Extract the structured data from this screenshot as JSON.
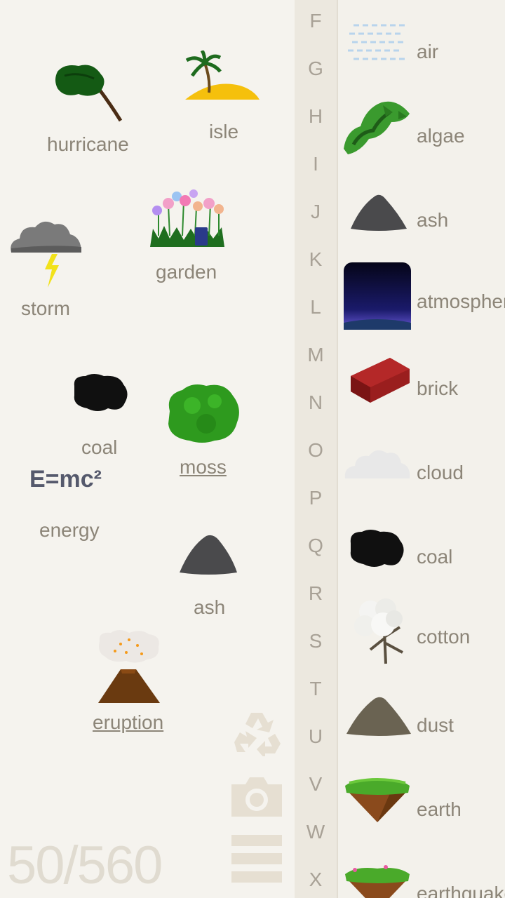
{
  "workspace": {
    "elements": [
      {
        "label": "hurricane"
      },
      {
        "label": "isle"
      },
      {
        "label": "storm"
      },
      {
        "label": "garden"
      },
      {
        "label": "coal"
      },
      {
        "label": "moss"
      },
      {
        "label": "energy",
        "formula": "E=mc²"
      },
      {
        "label": "ash"
      },
      {
        "label": "eruption"
      }
    ],
    "counter": "50/560"
  },
  "letters": [
    "F",
    "G",
    "H",
    "I",
    "J",
    "K",
    "L",
    "M",
    "N",
    "O",
    "P",
    "Q",
    "R",
    "S",
    "T",
    "U",
    "V",
    "W",
    "X"
  ],
  "library": [
    {
      "name": "air",
      "icon": "air-icon"
    },
    {
      "name": "algae",
      "icon": "algae-icon"
    },
    {
      "name": "ash",
      "icon": "ash-icon"
    },
    {
      "name": "atmosphere",
      "icon": "atmosphere-icon"
    },
    {
      "name": "brick",
      "icon": "brick-icon"
    },
    {
      "name": "cloud",
      "icon": "cloud-icon"
    },
    {
      "name": "coal",
      "icon": "coal-icon"
    },
    {
      "name": "cotton",
      "icon": "cotton-icon"
    },
    {
      "name": "dust",
      "icon": "dust-icon"
    },
    {
      "name": "earth",
      "icon": "earth-icon"
    },
    {
      "name": "earthquake",
      "icon": "earthquake-icon"
    }
  ],
  "tools": {
    "recycle": "recycle-icon",
    "camera": "camera-icon",
    "menu": "menu-icon"
  }
}
